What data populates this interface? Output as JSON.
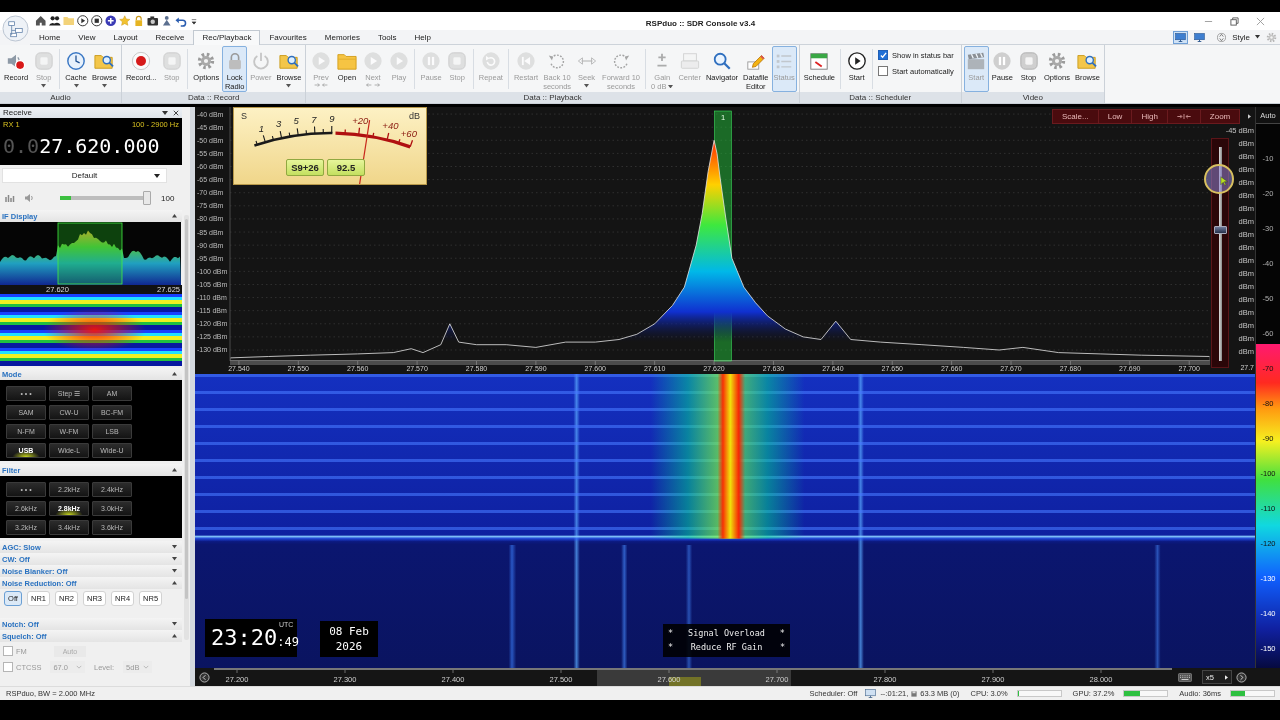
{
  "window": {
    "title": "RSPduo :: SDR Console v3.4"
  },
  "menu_tabs": [
    {
      "label": "Home",
      "selected": false
    },
    {
      "label": "View",
      "selected": false
    },
    {
      "label": "Layout",
      "selected": false
    },
    {
      "label": "Receive",
      "selected": false
    },
    {
      "label": "Rec/Playback",
      "selected": true
    },
    {
      "label": "Favourites",
      "selected": false
    },
    {
      "label": "Memories",
      "selected": false
    },
    {
      "label": "Tools",
      "selected": false
    },
    {
      "label": "Help",
      "selected": false
    }
  ],
  "layout_buttons": [
    {
      "selected": true
    },
    {
      "selected": false
    }
  ],
  "style_menu": {
    "label": "Style"
  },
  "ribbon_groups": [
    {
      "label": "Audio",
      "buttons": [
        {
          "label": "Record",
          "disabled": false,
          "active": false,
          "menu": false
        },
        {
          "label": "Stop",
          "disabled": true,
          "active": false,
          "menu": true
        },
        {
          "label": "Cache",
          "disabled": false,
          "active": false,
          "menu": true
        },
        {
          "label": "Browse",
          "disabled": false,
          "active": false,
          "menu": true
        }
      ]
    },
    {
      "label": "Data :: Record",
      "buttons": [
        {
          "label": "Record...",
          "disabled": false,
          "active": false,
          "menu": false
        },
        {
          "label": "Stop",
          "disabled": true,
          "active": false,
          "menu": false
        },
        {
          "label": "Options",
          "disabled": false,
          "active": false,
          "menu": false
        },
        {
          "label": "Lock\nRadio",
          "disabled": false,
          "active": true,
          "menu": false
        },
        {
          "label": "Power",
          "disabled": true,
          "active": false,
          "menu": false
        },
        {
          "label": "Browse",
          "disabled": false,
          "active": false,
          "menu": true
        }
      ]
    },
    {
      "label": "Data :: Playback",
      "buttons": [
        {
          "label": "Prev",
          "disabled": true,
          "active": false,
          "menu": false
        },
        {
          "label": "Open",
          "disabled": false,
          "active": false,
          "menu": false
        },
        {
          "label": "Next",
          "disabled": true,
          "active": false,
          "menu": false
        },
        {
          "label": "Play",
          "disabled": true,
          "active": false,
          "menu": false
        },
        {
          "label": "Pause",
          "disabled": true,
          "active": false,
          "menu": false
        },
        {
          "label": "Stop",
          "disabled": true,
          "active": false,
          "menu": false
        },
        {
          "label": "Repeat",
          "disabled": true,
          "active": false,
          "menu": false
        },
        {
          "label": "Restart",
          "disabled": true,
          "active": false,
          "menu": false
        },
        {
          "label": "Back 10\nseconds",
          "disabled": true,
          "active": false,
          "menu": false
        },
        {
          "label": "Seek",
          "disabled": true,
          "active": false,
          "menu": true
        },
        {
          "label": "Forward 10\nseconds",
          "disabled": true,
          "active": false,
          "menu": false
        },
        {
          "label": "Gain\n0 dB",
          "disabled": true,
          "active": false,
          "menu": true
        },
        {
          "label": "Center",
          "disabled": true,
          "active": false,
          "menu": false
        },
        {
          "label": "Navigator",
          "disabled": false,
          "active": false,
          "menu": false
        },
        {
          "label": "Datafile\nEditor",
          "disabled": false,
          "active": false,
          "menu": false
        },
        {
          "label": "Status",
          "disabled": true,
          "active": true,
          "menu": false
        }
      ]
    },
    {
      "label": "Data :: Scheduler",
      "buttons": [
        {
          "label": "Schedule",
          "disabled": false,
          "active": false,
          "menu": false
        },
        {
          "label": "Start",
          "disabled": false,
          "active": false,
          "menu": false
        }
      ],
      "options": [
        {
          "label": "Show in status bar",
          "checked": true
        },
        {
          "label": "Start automatically",
          "checked": false
        }
      ]
    },
    {
      "label": "Video",
      "buttons": [
        {
          "label": "Start",
          "disabled": true,
          "active": true,
          "menu": false
        },
        {
          "label": "Pause",
          "disabled": false,
          "active": false,
          "menu": false
        },
        {
          "label": "Stop",
          "disabled": false,
          "active": false,
          "menu": false
        },
        {
          "label": "Options",
          "disabled": false,
          "active": false,
          "menu": false
        },
        {
          "label": "Browse",
          "disabled": false,
          "active": false,
          "menu": false
        }
      ]
    }
  ],
  "receive_panel": {
    "title": "Receive",
    "rx_label": "RX 1",
    "bandwidth": "100 - 2900 Hz",
    "frequency_prefix": "0.0",
    "frequency": "27.620.000",
    "preset": "Default",
    "volume": {
      "level": 1,
      "reading": "100"
    },
    "sections": [
      {
        "kind": "if_display",
        "title": "IF Display",
        "expanded": true,
        "labels": [
          "27.620",
          "27.625"
        ]
      },
      {
        "kind": "grid",
        "title": "Mode",
        "expanded": true,
        "buttons": [
          {
            "label": "• • •",
            "selected": false
          },
          {
            "label": "Step ☰",
            "selected": false
          },
          {
            "label": "AM",
            "selected": false
          },
          {
            "label": "SAM",
            "selected": false
          },
          {
            "label": "CW-U",
            "selected": false
          },
          {
            "label": "BC-FM",
            "selected": false
          },
          {
            "label": "N-FM",
            "selected": false
          },
          {
            "label": "W-FM",
            "selected": false
          },
          {
            "label": "LSB",
            "selected": false
          },
          {
            "label": "USB",
            "selected": true
          },
          {
            "label": "Wide-L",
            "selected": false
          },
          {
            "label": "Wide-U",
            "selected": false
          }
        ]
      },
      {
        "kind": "grid",
        "title": "Filter",
        "expanded": true,
        "buttons": [
          {
            "label": "• • •",
            "selected": false
          },
          {
            "label": "2.2kHz",
            "selected": false
          },
          {
            "label": "2.4kHz",
            "selected": false
          },
          {
            "label": "2.6kHz",
            "selected": false
          },
          {
            "label": "2.8kHz",
            "selected": true
          },
          {
            "label": "3.0kHz",
            "selected": false
          },
          {
            "label": "3.2kHz",
            "selected": false
          },
          {
            "label": "3.4kHz",
            "selected": false
          },
          {
            "label": "3.6kHz",
            "selected": false
          }
        ]
      },
      {
        "kind": "header",
        "title": "AGC: Slow",
        "expanded": false
      },
      {
        "kind": "header",
        "title": "CW: Off",
        "expanded": false
      },
      {
        "kind": "header",
        "title": "Noise Blanker: Off",
        "expanded": false
      },
      {
        "kind": "buttons",
        "title": "Noise Reduction: Off",
        "expanded": true,
        "buttons": [
          {
            "label": "Off",
            "selected": true
          },
          {
            "label": "NR1",
            "selected": false
          },
          {
            "label": "NR2",
            "selected": false
          },
          {
            "label": "NR3",
            "selected": false
          },
          {
            "label": "NR4",
            "selected": false
          },
          {
            "label": "NR5",
            "selected": false
          }
        ]
      },
      {
        "kind": "header",
        "title": "Notch: Off",
        "expanded": false
      },
      {
        "kind": "squelch",
        "title": "Squelch: Off",
        "expanded": true,
        "controls_disabled": true,
        "fm": {
          "label": "FM",
          "checked": false
        },
        "auto": "Auto",
        "ctcss": {
          "label": "CTCSS",
          "checked": false
        },
        "tone": "67.0",
        "level_label": "Level:",
        "level_value": "5dB"
      }
    ]
  },
  "spectrum": {
    "toolbar": [
      {
        "kind": "text",
        "label": "Scale..."
      },
      {
        "kind": "text",
        "label": "Low"
      },
      {
        "kind": "text",
        "label": "High"
      },
      {
        "kind": "icon"
      },
      {
        "kind": "text",
        "label": "Zoom"
      }
    ],
    "s_meter": {
      "unit_left": "S",
      "scale_labels": [
        "1",
        "3",
        "5",
        "7",
        "9"
      ],
      "over_labels": [
        "+20",
        "+40",
        "+60"
      ],
      "unit_right": "dB",
      "level": 0.72,
      "readings": [
        "S9+26",
        "92.5"
      ]
    },
    "chart_data": {
      "type": "area",
      "x": [
        27.5385,
        27.545,
        27.552,
        27.56,
        27.566,
        27.569,
        27.571,
        27.574,
        27.5755,
        27.577,
        27.58,
        27.585,
        27.59,
        27.595,
        27.6,
        27.604,
        27.607,
        27.61,
        27.613,
        27.615,
        27.617,
        27.618,
        27.619,
        27.62,
        27.6205,
        27.621,
        27.622,
        27.623,
        27.625,
        27.627,
        27.629,
        27.632,
        27.635,
        27.638,
        27.6405,
        27.643,
        27.648,
        27.655,
        27.662,
        27.668,
        27.672,
        27.678,
        27.685,
        27.692,
        27.7035
      ],
      "values": [
        -133,
        -132.5,
        -132,
        -131.5,
        -131,
        -129.5,
        -131,
        -128,
        -120,
        -127,
        -128,
        -128,
        -129,
        -127,
        -127,
        -126,
        -124,
        -120,
        -113,
        -106,
        -90,
        -78,
        -62,
        -50,
        -55,
        -64,
        -80,
        -95,
        -106,
        -112,
        -117,
        -122,
        -125,
        -126,
        -119,
        -126,
        -127,
        -128,
        -129,
        -130,
        -129,
        -131,
        -131.5,
        -132,
        -132.5
      ],
      "xlim": [
        27.5385,
        27.7035
      ],
      "ylim": [
        -134.2,
        -37.3
      ],
      "grid": true,
      "xticks": [
        {
          "value": 27.54,
          "label": "27.540"
        },
        {
          "value": 27.55,
          "label": "27.550"
        },
        {
          "value": 27.56,
          "label": "27.560"
        },
        {
          "value": 27.57,
          "label": "27.570"
        },
        {
          "value": 27.58,
          "label": "27.580"
        },
        {
          "value": 27.59,
          "label": "27.590"
        },
        {
          "value": 27.6,
          "label": "27.600"
        },
        {
          "value": 27.61,
          "label": "27.610"
        },
        {
          "value": 27.62,
          "label": "27.620"
        },
        {
          "value": 27.63,
          "label": "27.630"
        },
        {
          "value": 27.64,
          "label": "27.640"
        },
        {
          "value": 27.65,
          "label": "27.650"
        },
        {
          "value": 27.66,
          "label": "27.660"
        },
        {
          "value": 27.67,
          "label": "27.670"
        },
        {
          "value": 27.68,
          "label": "27.680"
        },
        {
          "value": 27.69,
          "label": "27.690"
        },
        {
          "value": 27.7,
          "label": "27.700"
        }
      ],
      "yticks": [
        {
          "value": -40,
          "label": "-40 dBm"
        },
        {
          "value": -45,
          "label": "-45 dBm"
        },
        {
          "value": -50,
          "label": "-50 dBm"
        },
        {
          "value": -55,
          "label": "-55 dBm"
        },
        {
          "value": -60,
          "label": "-60 dBm"
        },
        {
          "value": -65,
          "label": "-65 dBm"
        },
        {
          "value": -70,
          "label": "-70 dBm"
        },
        {
          "value": -75,
          "label": "-75 dBm"
        },
        {
          "value": -80,
          "label": "-80 dBm"
        },
        {
          "value": -85,
          "label": "-85 dBm"
        },
        {
          "value": -90,
          "label": "-90 dBm"
        },
        {
          "value": -95,
          "label": "-95 dBm"
        },
        {
          "value": -100,
          "label": "-100 dBm"
        },
        {
          "value": -105,
          "label": "-105 dBm"
        },
        {
          "value": -110,
          "label": "-110 dBm"
        },
        {
          "value": -115,
          "label": "-115 dBm"
        },
        {
          "value": -120,
          "label": "-120 dBm"
        },
        {
          "value": -125,
          "label": "-125 dBm"
        },
        {
          "value": -130,
          "label": "-130 dBm"
        }
      ],
      "bands": [
        {
          "axis": "x",
          "from": 27.6201,
          "to": 27.6229,
          "label": "1"
        }
      ]
    },
    "top_label": "-45 dBm",
    "side_labels": [
      "dBm",
      "dBm",
      "dBm",
      "dBm",
      "dBm",
      "dBm",
      "dBm",
      "dBm",
      "dBm",
      "dBm",
      "dBm",
      "dBm",
      "dBm",
      "dBm",
      "dBm",
      "dBm",
      "dBm"
    ],
    "edge_label": "27.7",
    "gain_slider": {
      "level": 0.61
    }
  },
  "level_scale": {
    "header": "Auto",
    "labels": [
      "-10",
      "-20",
      "-30",
      "-40",
      "-50",
      "-60",
      "-70",
      "-80",
      "-90",
      "-100",
      "-110",
      "-120",
      "-130",
      "-140",
      "-150"
    ]
  },
  "waterfall": {
    "clock": {
      "time": "23:20",
      "seconds": ":49",
      "zone": "UTC",
      "date": "08 Feb",
      "year": "2026"
    },
    "alerts": [
      {
        "lead": "*",
        "text": "Signal Overload",
        "trail": "*"
      },
      {
        "lead": "*",
        "text": "Reduce RF Gain",
        "trail": "*"
      }
    ],
    "axis_labels": [
      "27.200",
      "27.300",
      "27.400",
      "27.500",
      "27.600",
      "27.700",
      "27.800",
      "27.900",
      "28.000"
    ],
    "zoom_label": "x5"
  },
  "status_bar": {
    "device": "RSPduo, BW = 2.000 MHz",
    "scheduler": "Scheduler: Off",
    "recording_time": "--:01:21,",
    "recording_size": "63.3 MB (0)",
    "meters": [
      {
        "label": "CPU: 3.0%",
        "level": 0.03
      },
      {
        "label": "GPU: 37.2%",
        "level": 0.37
      },
      {
        "label": "Audio: 36ms",
        "level": 0.33
      }
    ]
  }
}
